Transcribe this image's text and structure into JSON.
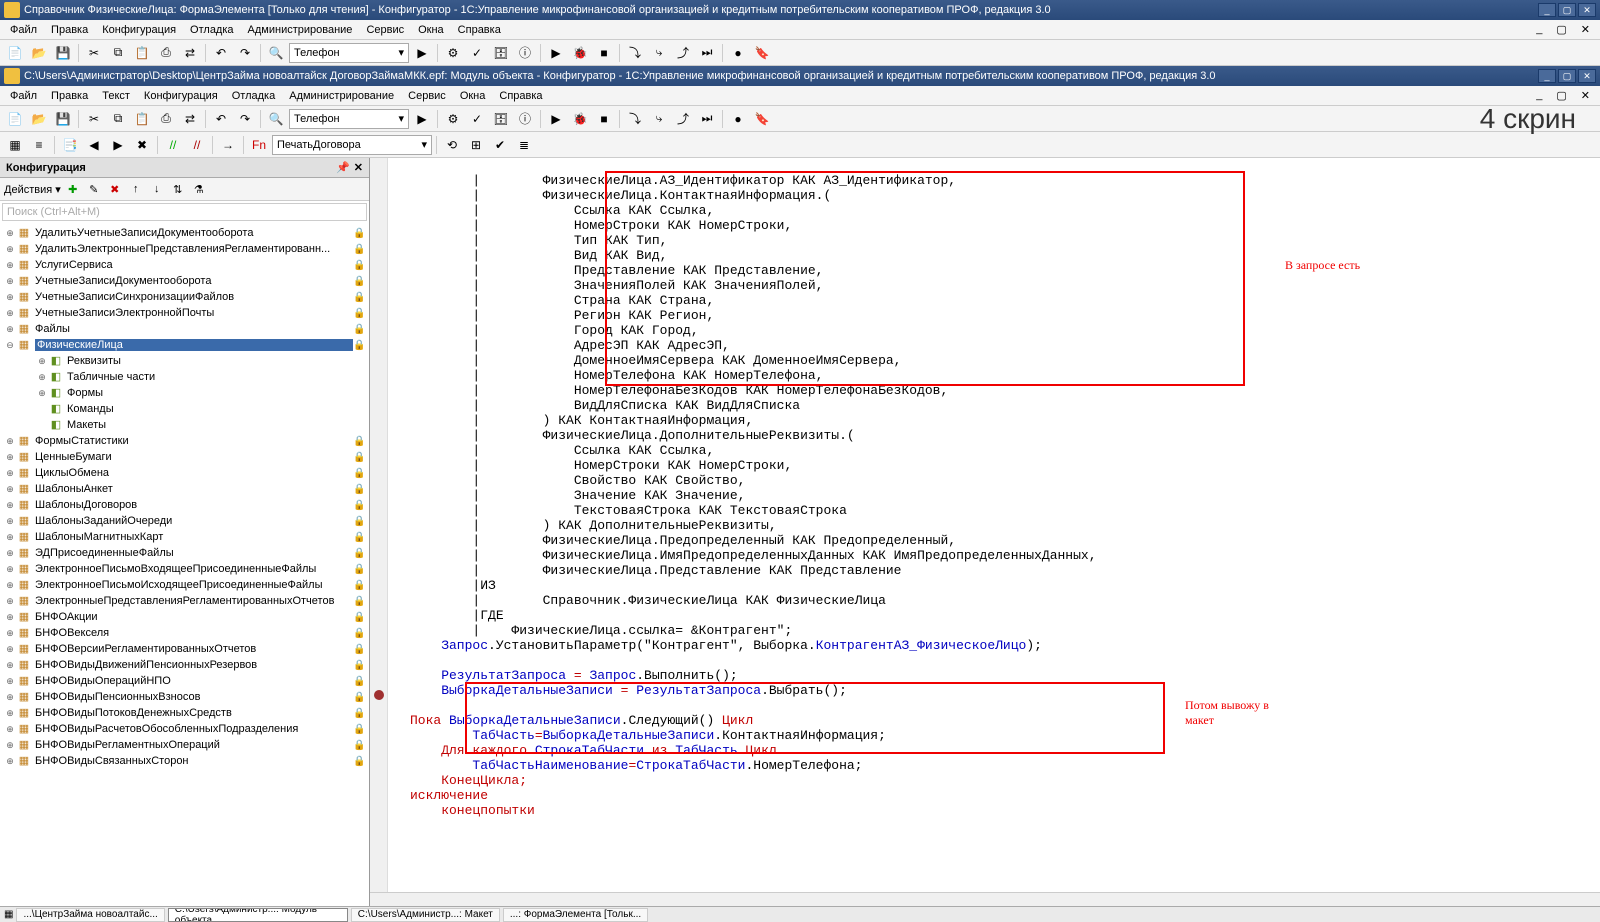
{
  "window1": {
    "title": "Справочник ФизическиеЛица: ФормаЭлемента [Только для чтения] - Конфигуратор - 1С:Управление микрофинансовой организацией и кредитным потребительским кооперативом ПРОФ, редакция 3.0",
    "menu": [
      "Файл",
      "Правка",
      "Конфигурация",
      "Отладка",
      "Администрирование",
      "Сервис",
      "Окна",
      "Справка"
    ]
  },
  "window2": {
    "title": "C:\\Users\\Администратор\\Desktop\\ЦентрЗайма новоалтайск ДоговорЗаймаМКК.epf: Модуль объекта - Конфигуратор - 1С:Управление микрофинансовой организацией и кредитным потребительским кооперативом ПРОФ, редакция 3.0",
    "menu": [
      "Файл",
      "Правка",
      "Текст",
      "Конфигурация",
      "Отладка",
      "Администрирование",
      "Сервис",
      "Окна",
      "Справка"
    ]
  },
  "toolbar": {
    "combo1": "Телефон",
    "combo2": "ПечатьДоговора"
  },
  "big_label": "4 скрин",
  "sidebar": {
    "title": "Конфигурация",
    "actions_label": "Действия ▾",
    "search_placeholder": "Поиск (Ctrl+Alt+M)",
    "items": [
      {
        "exp": "⊕",
        "label": "УдалитьУчетныеЗаписиДокументооборота",
        "lock": true,
        "icon": "cat"
      },
      {
        "exp": "⊕",
        "label": "УдалитьЭлектронныеПредставленияРегламентированн...",
        "lock": true,
        "icon": "cat"
      },
      {
        "exp": "⊕",
        "label": "УслугиСервиса",
        "lock": true,
        "icon": "cat"
      },
      {
        "exp": "⊕",
        "label": "УчетныеЗаписиДокументооборота",
        "lock": true,
        "icon": "cat"
      },
      {
        "exp": "⊕",
        "label": "УчетныеЗаписиСинхронизацииФайлов",
        "lock": true,
        "icon": "cat"
      },
      {
        "exp": "⊕",
        "label": "УчетныеЗаписиЭлектроннойПочты",
        "lock": true,
        "icon": "cat"
      },
      {
        "exp": "⊕",
        "label": "Файлы",
        "lock": true,
        "icon": "cat"
      },
      {
        "exp": "⊖",
        "label": "ФизическиеЛица",
        "lock": true,
        "icon": "cat",
        "selected": true
      },
      {
        "exp": "⊕",
        "label": "Реквизиты",
        "indent": 2,
        "icon": "sub"
      },
      {
        "exp": "⊕",
        "label": "Табличные части",
        "indent": 2,
        "icon": "sub"
      },
      {
        "exp": "⊕",
        "label": "Формы",
        "indent": 2,
        "icon": "sub"
      },
      {
        "exp": "",
        "label": "Команды",
        "indent": 2,
        "icon": "sub"
      },
      {
        "exp": "",
        "label": "Макеты",
        "indent": 2,
        "icon": "sub"
      },
      {
        "exp": "⊕",
        "label": "ФормыСтатистики",
        "lock": true,
        "icon": "cat"
      },
      {
        "exp": "⊕",
        "label": "ЦенныеБумаги",
        "lock": true,
        "icon": "cat"
      },
      {
        "exp": "⊕",
        "label": "ЦиклыОбмена",
        "lock": true,
        "icon": "cat"
      },
      {
        "exp": "⊕",
        "label": "ШаблоныАнкет",
        "lock": true,
        "icon": "cat"
      },
      {
        "exp": "⊕",
        "label": "ШаблоныДоговоров",
        "lock": true,
        "icon": "cat"
      },
      {
        "exp": "⊕",
        "label": "ШаблоныЗаданийОчереди",
        "lock": true,
        "icon": "cat"
      },
      {
        "exp": "⊕",
        "label": "ШаблоныМагнитныхКарт",
        "lock": true,
        "icon": "cat"
      },
      {
        "exp": "⊕",
        "label": "ЭДПрисоединенныеФайлы",
        "lock": true,
        "icon": "cat"
      },
      {
        "exp": "⊕",
        "label": "ЭлектронноеПисьмоВходящееПрисоединенныеФайлы",
        "lock": true,
        "icon": "cat"
      },
      {
        "exp": "⊕",
        "label": "ЭлектронноеПисьмоИсходящееПрисоединенныеФайлы",
        "lock": true,
        "icon": "cat"
      },
      {
        "exp": "⊕",
        "label": "ЭлектронныеПредставленияРегламентированныхОтчетов",
        "lock": true,
        "icon": "cat"
      },
      {
        "exp": "⊕",
        "label": "БНФОАкции",
        "lock": true,
        "icon": "cat"
      },
      {
        "exp": "⊕",
        "label": "БНФОВекселя",
        "lock": true,
        "icon": "cat"
      },
      {
        "exp": "⊕",
        "label": "БНФОВерсииРегламентированныхОтчетов",
        "lock": true,
        "icon": "cat"
      },
      {
        "exp": "⊕",
        "label": "БНФОВидыДвиженийПенсионныхРезервов",
        "lock": true,
        "icon": "cat"
      },
      {
        "exp": "⊕",
        "label": "БНФОВидыОперацийНПО",
        "lock": true,
        "icon": "cat"
      },
      {
        "exp": "⊕",
        "label": "БНФОВидыПенсионныхВзносов",
        "lock": true,
        "icon": "cat"
      },
      {
        "exp": "⊕",
        "label": "БНФОВидыПотоковДенежныхСредств",
        "lock": true,
        "icon": "cat"
      },
      {
        "exp": "⊕",
        "label": "БНФОВидыРасчетовОбособленныхПодразделения",
        "lock": true,
        "icon": "cat"
      },
      {
        "exp": "⊕",
        "label": "БНФОВидыРегламентныхОпераций",
        "lock": true,
        "icon": "cat"
      },
      {
        "exp": "⊕",
        "label": "БНФОВидыСвязанныхСторон",
        "lock": true,
        "icon": "cat"
      }
    ]
  },
  "annotations": {
    "a1": "В запросе есть",
    "a2_line1": "Потом вывожу в",
    "a2_line2": "макет"
  },
  "code": {
    "l01": "        |        ФизическиеЛица.АЗ_Идентификатор КАК АЗ_Идентификатор,",
    "l02": "        |        ФизическиеЛица.КонтактнаяИнформация.(",
    "l03": "        |            Ссылка КАК Ссылка,",
    "l04": "        |            НомерСтроки КАК НомерСтроки,",
    "l05": "        |            Тип КАК Тип,",
    "l06": "        |            Вид КАК Вид,",
    "l07": "        |            Представление КАК Представление,",
    "l08": "        |            ЗначенияПолей КАК ЗначенияПолей,",
    "l09": "        |            Страна КАК Страна,",
    "l10": "        |            Регион КАК Регион,",
    "l11": "        |            Город КАК Город,",
    "l12": "        |            АдресЭП КАК АдресЭП,",
    "l13": "        |            ДоменноеИмяСервера КАК ДоменноеИмяСервера,",
    "l14": "        |            НомерТелефона КАК НомерТелефона,",
    "l15": "        |            НомерТелефонаБезКодов КАК НомерТелефонаБезКодов,",
    "l16": "        |            ВидДляСписка КАК ВидДляСписка",
    "l17": "        |        ) КАК КонтактнаяИнформация,",
    "l18": "        |        ФизическиеЛица.ДополнительныеРеквизиты.(",
    "l19": "        |            Ссылка КАК Ссылка,",
    "l20": "        |            НомерСтроки КАК НомерСтроки,",
    "l21": "        |            Свойство КАК Свойство,",
    "l22": "        |            Значение КАК Значение,",
    "l23": "        |            ТекстоваяСтрока КАК ТекстоваяСтрока",
    "l24": "        |        ) КАК ДополнительныеРеквизиты,",
    "l25": "        |        ФизическиеЛица.Предопределенный КАК Предопределенный,",
    "l26": "        |        ФизическиеЛица.ИмяПредопределенныхДанных КАК ИмяПредопределенныхДанных,",
    "l27": "        |        ФизическиеЛица.Представление КАК Представление",
    "l28": "        |ИЗ",
    "l29": "        |        Справочник.ФизическиеЛица КАК ФизическиеЛица",
    "l30": "        |ГДЕ",
    "l31": "        |    ФизическиеЛица.ссылка= &Контрагент\";",
    "l32a": "    Запрос",
    "l32b": ".УстановитьПараметр(",
    "l32c": "\"Контрагент\"",
    "l32d": ", Выборка.",
    "l32e": "КонтрагентАЗ_ФизическоеЛицо",
    "l32f": ");",
    "l34a": "    РезультатЗапроса ",
    "l34b": "=",
    "l34c": " Запрос",
    "l34d": ".Выполнить();",
    "l35a": "    ВыборкаДетальныеЗаписи ",
    "l35b": "=",
    "l35c": " РезультатЗапроса",
    "l35d": ".Выбрать();",
    "l37a": "Пока ",
    "l37b": "ВыборкаДетальныеЗаписи",
    "l37c": ".Следующий() ",
    "l37d": "Цикл",
    "l38a": "        ТабЧасть",
    "l38b": "=",
    "l38c": "ВыборкаДетальныеЗаписи",
    "l38d": ".КонтактнаяИнформация;",
    "l39a": "    Для каждого ",
    "l39b": "СтрокаТабЧасти ",
    "l39c": "из ",
    "l39d": "ТабЧасть ",
    "l39e": "Цикл",
    "l40a": "        ТабЧастьНаименование",
    "l40b": "=",
    "l40c": "СтрокаТабЧасти",
    "l40d": ".НомерТелефона;",
    "l41": "    КонецЦикла;",
    "l42": "исключение",
    "l43": "    конецпопытки"
  },
  "taskbar": {
    "t1": "...\\ЦентрЗайма новоалтайс...",
    "t2": "C:\\Users\\Администр...: Модуль объекта",
    "t3": "C:\\Users\\Администр...: Макет",
    "t4": "...: ФормаЭлемента [Тольк..."
  }
}
